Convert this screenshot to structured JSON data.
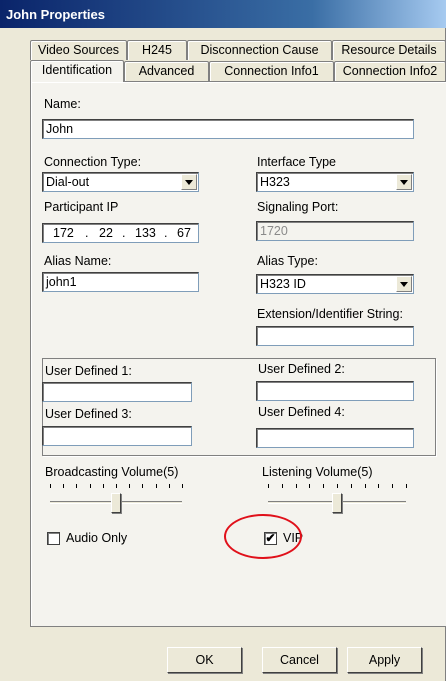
{
  "window": {
    "title": "John Properties"
  },
  "tabs_back": [
    "Video Sources",
    "H245",
    "Disconnection Cause",
    "Resource Details"
  ],
  "tabs_front": [
    "Identification",
    "Advanced",
    "Connection Info1",
    "Connection Info2"
  ],
  "active_tab": "Identification",
  "form": {
    "name_label": "Name:",
    "name_value": "John",
    "connection_type_label": "Connection Type:",
    "connection_type_value": "Dial-out",
    "interface_type_label": "Interface Type",
    "interface_type_value": "H323",
    "participant_ip_label": "Participant IP",
    "participant_ip_octets": [
      "172",
      "22",
      "133",
      "67"
    ],
    "signaling_port_label": "Signaling Port:",
    "signaling_port_value": "1720",
    "alias_name_label": "Alias Name:",
    "alias_name_value": "john1",
    "alias_type_label": "Alias Type:",
    "alias_type_value": "H323 ID",
    "extension_label": "Extension/Identifier String:",
    "extension_value": "",
    "user_defined_1_label": "User Defined 1:",
    "user_defined_2_label": "User Defined 2:",
    "user_defined_3_label": "User Defined 3:",
    "user_defined_4_label": "User Defined 4:",
    "broadcasting_volume_label": "Broadcasting Volume(5)",
    "broadcasting_volume_value": 5,
    "listening_volume_label": "Listening Volume(5)",
    "listening_volume_value": 5,
    "volume_max": 10,
    "audio_only_label": "Audio Only",
    "audio_only_checked": false,
    "vip_label": "VIP",
    "vip_checked": true
  },
  "buttons": {
    "ok": "OK",
    "cancel": "Cancel",
    "apply": "Apply"
  },
  "colors": {
    "highlight": "#e0101a",
    "title_bar": "#0a246a"
  }
}
